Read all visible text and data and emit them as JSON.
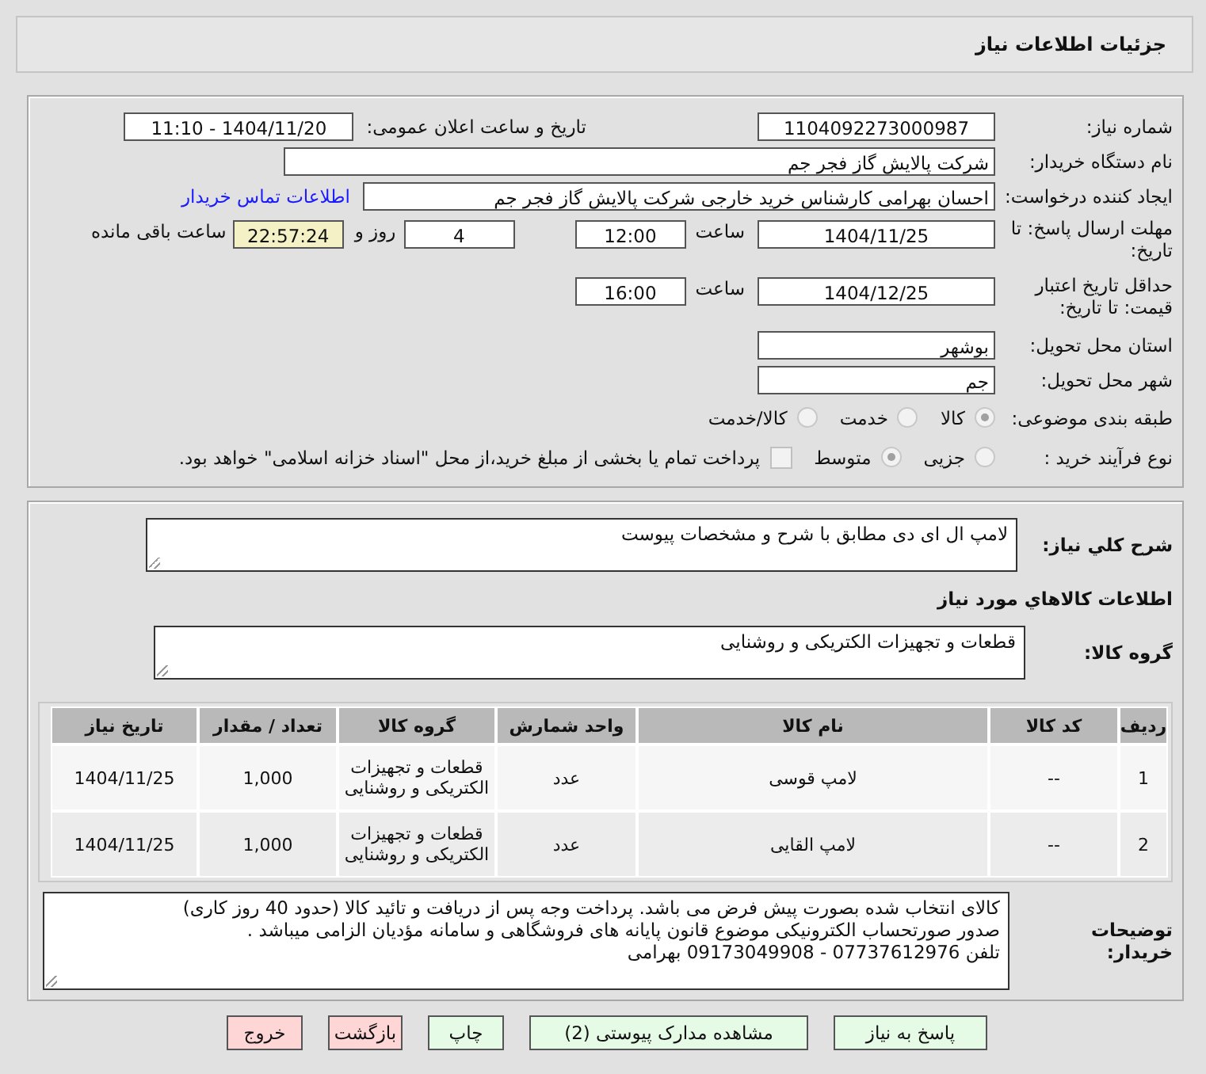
{
  "title": "جزئیات اطلاعات نیاز",
  "need_number": {
    "label": "شماره نیاز:",
    "value": "1104092273000987"
  },
  "announce": {
    "label": "تاریخ و ساعت اعلان عمومی:",
    "value": "1404/11/20 - 11:10"
  },
  "buyer": {
    "label": "نام دستگاه خریدار:",
    "value": "شرکت پالایش گاز فجر جم"
  },
  "creator": {
    "label": "ایجاد کننده درخواست:",
    "value": "احسان بهرامی کارشناس خرید خارجی شرکت پالایش گاز فجر جم",
    "link": "اطلاعات تماس خریدار"
  },
  "deadline": {
    "label": "مهلت ارسال پاسخ: تا تاریخ:",
    "date": "1404/11/25",
    "time_label": "ساعت",
    "time": "12:00",
    "days": "4",
    "days_label": "روز و",
    "remaining": "22:57:24",
    "remaining_label": "ساعت باقی مانده"
  },
  "validity": {
    "label": "حداقل تاریخ اعتبار قیمت: تا تاریخ:",
    "date": "1404/12/25",
    "time_label": "ساعت",
    "time": "16:00"
  },
  "province": {
    "label": "استان محل تحویل:",
    "value": "بوشهر"
  },
  "city": {
    "label": "شهر محل تحویل:",
    "value": "جم"
  },
  "category": {
    "label": "طبقه بندی موضوعی:",
    "options": [
      {
        "label": "کالا",
        "selected": true
      },
      {
        "label": "خدمت",
        "selected": false
      },
      {
        "label": "کالا/خدمت",
        "selected": false
      }
    ]
  },
  "process": {
    "label": "نوع فرآیند خرید :",
    "options": [
      {
        "label": "جزیی",
        "selected": false
      },
      {
        "label": "متوسط",
        "selected": true
      }
    ],
    "checkbox": {
      "label": "پرداخت تمام یا بخشی از مبلغ خرید،از محل \"اسناد خزانه اسلامی\" خواهد بود.",
      "checked": false
    }
  },
  "summary": {
    "label": "شرح کلي نیاز:",
    "value": "لامپ ال ای دی مطابق با شرح و مشخصات پیوست"
  },
  "goods_heading": "اطلاعات کالاهاي مورد نیاز",
  "goods_group": {
    "label": "گروه کالا:",
    "value": "قطعات و تجهیزات الکتریکی و روشنایی"
  },
  "table": {
    "columns": [
      "ردیف",
      "کد کالا",
      "نام کالا",
      "واحد شمارش",
      "گروه کالا",
      "تعداد / مقدار",
      "تاریخ نیاز"
    ],
    "rows": [
      [
        "1",
        "--",
        "لامپ قوسی",
        "عدد",
        "قطعات و تجهیزات الکتریکی و روشنایی",
        "1,000",
        "1404/11/25"
      ],
      [
        "2",
        "--",
        "لامپ القایی",
        "عدد",
        "قطعات و تجهیزات الکتریکی و روشنایی",
        "1,000",
        "1404/11/25"
      ]
    ]
  },
  "notes": {
    "label": "توضیحات خریدار:",
    "lines": [
      "کالای انتخاب شده بصورت پیش فرض می باشد. پرداخت وجه پس از دریافت و تائید کالا (حدود 40 روز کاری)",
      "صدور صورتحساب الکترونیکی موضوع قانون پایانه های فروشگاهی و سامانه مؤدیان الزامی میباشد .",
      "تلفن 07737612976 - 09173049908 بهرامی"
    ]
  },
  "buttons": [
    {
      "label": "پاسخ به نیاز",
      "kind": "go"
    },
    {
      "label": "مشاهده مدارک پیوستی (2)",
      "kind": "go"
    },
    {
      "label": "چاپ",
      "kind": "go"
    },
    {
      "label": "بازگشت",
      "kind": "stop"
    },
    {
      "label": "خروج",
      "kind": "stop"
    }
  ]
}
